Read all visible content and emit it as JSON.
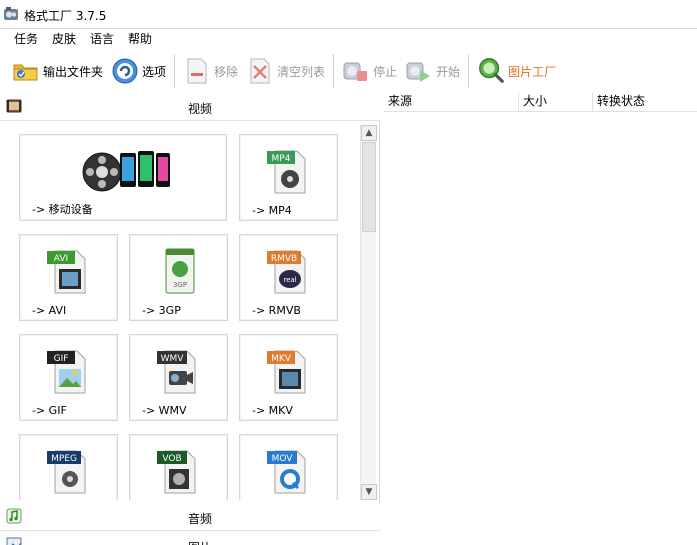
{
  "window": {
    "title": "格式工厂 3.7.5"
  },
  "menu": [
    "任务",
    "皮肤",
    "语言",
    "帮助"
  ],
  "toolbar": {
    "output_folder": "输出文件夹",
    "options": "选项",
    "remove": "移除",
    "clear_list": "清空列表",
    "stop": "停止",
    "start": "开始",
    "picture_factory": "图片工厂"
  },
  "categories": {
    "video": "视频",
    "audio": "音频",
    "picture": "图片"
  },
  "tiles": [
    {
      "label": "-> 移动设备",
      "badge": ""
    },
    {
      "label": "-> MP4",
      "badge": "MP4"
    },
    {
      "label": "-> AVI",
      "badge": "AVI"
    },
    {
      "label": "-> 3GP",
      "badge": "3GP"
    },
    {
      "label": "-> RMVB",
      "badge": "RMVB"
    },
    {
      "label": "-> GIF",
      "badge": "GIF"
    },
    {
      "label": "-> WMV",
      "badge": "WMV"
    },
    {
      "label": "-> MKV",
      "badge": "MKV"
    },
    {
      "label": "",
      "badge": "MPEG"
    },
    {
      "label": "",
      "badge": "VOB"
    },
    {
      "label": "",
      "badge": "MOV"
    }
  ],
  "columns": [
    "来源",
    "大小",
    "转换状态"
  ],
  "colors": {
    "mp4_badge": "#3a9a5a",
    "avi_badge": "#3c9b2e",
    "rmvb_badge": "#e07a30",
    "gif_badge": "#222222",
    "wmv_badge": "#333333",
    "mkv_badge": "#e07a30",
    "mpeg_badge": "#1a3a6a",
    "vob_badge": "#1d5a2a",
    "mov_badge": "#2a7ad0",
    "orange_text": "#e0701c"
  }
}
